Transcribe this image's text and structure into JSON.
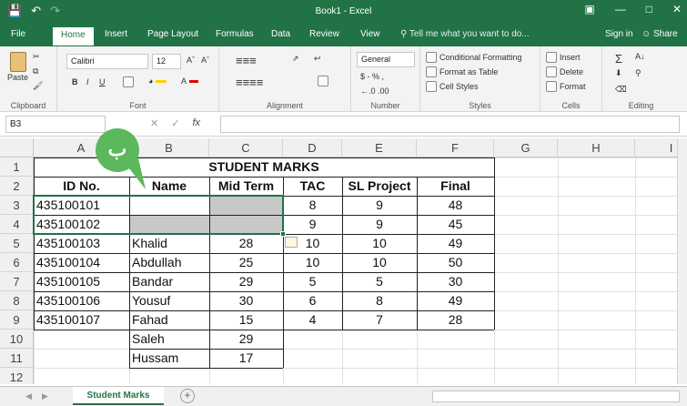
{
  "titlebar": {
    "title": "Book1 - Excel",
    "save_icon": "save-icon",
    "undo_icon": "undo-icon",
    "redo_icon": "redo-icon"
  },
  "tabs": [
    {
      "label": "File"
    },
    {
      "label": "Home"
    },
    {
      "label": "Insert"
    },
    {
      "label": "Page Layout"
    },
    {
      "label": "Formulas"
    },
    {
      "label": "Data"
    },
    {
      "label": "Review"
    },
    {
      "label": "View"
    }
  ],
  "tell_me": "Tell me what you want to do...",
  "sign_in": "Sign in",
  "share": "Share",
  "ribbon": {
    "clipboard": {
      "label": "Clipboard",
      "paste": "Paste"
    },
    "font": {
      "label": "Font",
      "name": "Calibri",
      "size": "12",
      "bold": "B",
      "italic": "I",
      "underline": "U"
    },
    "alignment": {
      "label": "Alignment"
    },
    "number": {
      "label": "Number",
      "format": "General",
      "currency": "$ - % ,"
    },
    "styles": {
      "label": "Styles",
      "conditional": "Conditional Formatting",
      "format_table": "Format as Table",
      "cell_styles": "Cell Styles"
    },
    "cells": {
      "label": "Cells",
      "insert": "Insert",
      "delete": "Delete",
      "format": "Format"
    },
    "editing": {
      "label": "Editing"
    }
  },
  "formula_bar": {
    "name_box": "B3",
    "formula": ""
  },
  "columns": [
    "A",
    "B",
    "C",
    "D",
    "E",
    "F",
    "G",
    "H",
    "I"
  ],
  "rows": [
    "1",
    "2",
    "3",
    "4",
    "5",
    "6",
    "7",
    "8",
    "9",
    "10",
    "11",
    "12"
  ],
  "table": {
    "title": "STUDENT MARKS",
    "headers": [
      "ID No.",
      "Name",
      "Mid Term",
      "TAC",
      "SL Project",
      "Final"
    ],
    "data": [
      [
        "435100101",
        "",
        "",
        "8",
        "9",
        "48"
      ],
      [
        "435100102",
        "",
        "",
        "9",
        "9",
        "45"
      ],
      [
        "435100103",
        "Khalid",
        "28",
        "10",
        "10",
        "49"
      ],
      [
        "435100104",
        "Abdullah",
        "25",
        "10",
        "10",
        "50"
      ],
      [
        "435100105",
        "Bandar",
        "29",
        "5",
        "5",
        "30"
      ],
      [
        "435100106",
        "Yousuf",
        "30",
        "6",
        "8",
        "49"
      ],
      [
        "435100107",
        "Fahad",
        "15",
        "4",
        "7",
        "28"
      ],
      [
        "",
        "Saleh",
        "29",
        "",
        "",
        ""
      ],
      [
        "",
        "Hussam",
        "17",
        "",
        "",
        ""
      ]
    ]
  },
  "sheet": {
    "name": "Student Marks",
    "add": "+"
  },
  "annotation": {
    "label": "ب"
  },
  "colors": {
    "excel_green": "#217346",
    "bubble_green": "#5cb85c",
    "selection_gray": "#c8c8c8"
  }
}
